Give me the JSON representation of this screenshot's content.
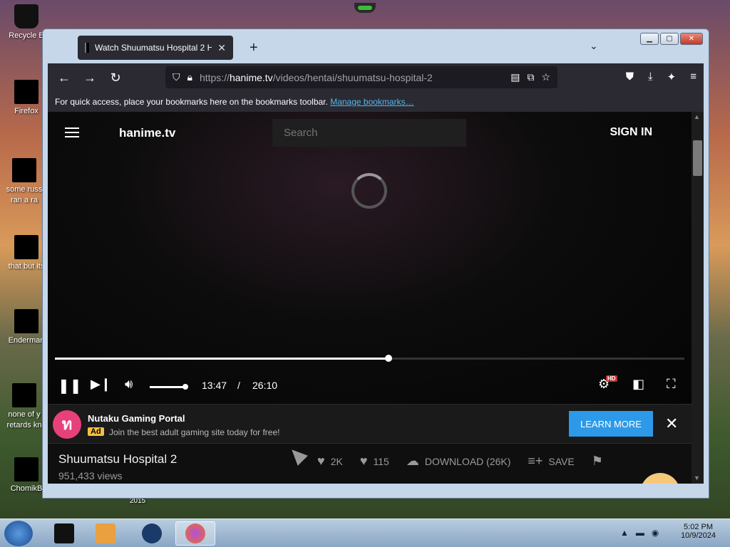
{
  "desktop": {
    "icons": [
      {
        "label": "Recycle B",
        "name": "recycle-bin"
      },
      {
        "label": "Firefox",
        "name": "firefox"
      },
      {
        "label": "some russ ran a ra",
        "name": "file-russ"
      },
      {
        "label": "that but its",
        "name": "file-that"
      },
      {
        "label": "Enderman",
        "name": "enderman"
      },
      {
        "label": "none of y retards kn",
        "name": "file-none"
      },
      {
        "label": "ChomikB",
        "name": "chomik"
      }
    ],
    "year_label": "2015"
  },
  "browser": {
    "tab_title": "Watch Shuumatsu Hospital 2 H",
    "new_tab": "+",
    "tab_menu": "⌄",
    "url_prefix": "https://",
    "url_host": "hanime.tv",
    "url_path": "/videos/hentai/shuumatsu-hospital-2",
    "bookmarks_text": "For quick access, place your bookmarks here on the bookmarks toolbar.",
    "bookmarks_link": "Manage bookmarks…",
    "window_controls": {
      "minimize": "▁",
      "maximize": "▢",
      "close": "✕"
    }
  },
  "site": {
    "logo": "hanime.tv",
    "search_placeholder": "Search",
    "signin": "SIGN IN"
  },
  "player": {
    "current_time": "13:47",
    "separator": "/",
    "duration": "26:10",
    "progress_fraction": 0.53,
    "volume_fraction": 1.0,
    "hd_badge": "HD"
  },
  "ad": {
    "title": "Nutaku Gaming Portal",
    "tag": "Ad",
    "description": "Join the best adult gaming site today for free!",
    "cta": "LEARN MORE",
    "close": "✕"
  },
  "video_info": {
    "title": "Shuumatsu Hospital 2",
    "views": "951,433 views",
    "likes": "2K",
    "dislikes": "115",
    "download": "DOWNLOAD (26K)",
    "save": "SAVE"
  },
  "taskbar": {
    "time": "5:02 PM",
    "date": "10/9/2024"
  }
}
